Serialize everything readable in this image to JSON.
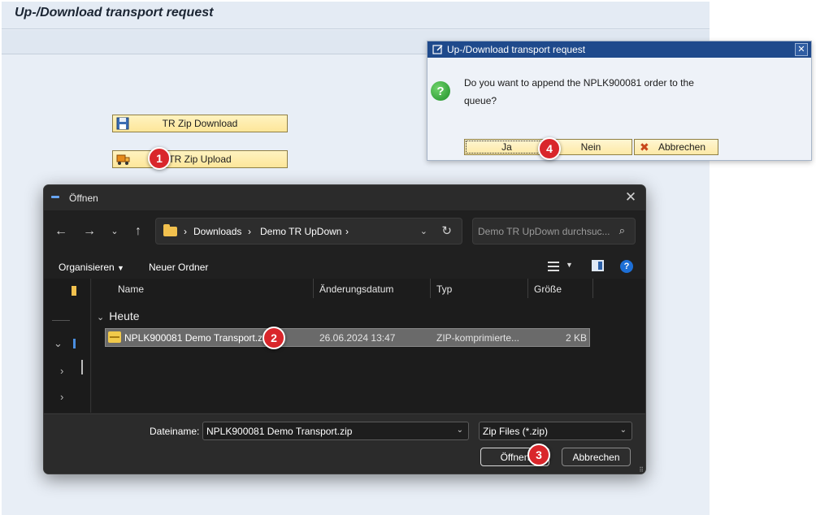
{
  "sap": {
    "title": "Up-/Download transport request",
    "buttons": {
      "download": {
        "label": "TR Zip Download",
        "icon": "floppy-disk-icon"
      },
      "upload": {
        "label": "TR Zip Upload",
        "icon": "truck-icon"
      }
    }
  },
  "confirm_dialog": {
    "title": "Up-/Download transport request",
    "message": "Do you want to append the NPLK900081 order to the queue?",
    "icon": "question-icon",
    "buttons": {
      "yes": "Ja",
      "no": "Nein",
      "cancel": "Abbrechen"
    },
    "close_icon": "close-icon"
  },
  "file_dialog": {
    "title": "Öffnen",
    "address": {
      "segments": [
        "Downloads",
        "Demo TR UpDown"
      ]
    },
    "search_placeholder": "Demo TR UpDown durchsuc...",
    "commands": {
      "organize": "Organisieren",
      "new_folder": "Neuer Ordner"
    },
    "columns": {
      "name": "Name",
      "modified": "Änderungsdatum",
      "type": "Typ",
      "size": "Größe"
    },
    "group": "Heute",
    "file": {
      "name": "NPLK900081 Demo Transport.zip",
      "modified": "26.06.2024 13:47",
      "type": "ZIP-komprimierte...",
      "size": "2 KB"
    },
    "filename_label": "Dateiname:",
    "filename_value": "NPLK900081 Demo Transport.zip",
    "filter_value": "Zip Files (*.zip)",
    "buttons": {
      "open": "Öffnen",
      "cancel": "Abbrechen"
    }
  },
  "markers": [
    "1",
    "2",
    "3",
    "4"
  ],
  "colors": {
    "marker": "#d9262b",
    "sap_button": "#fde69a",
    "sap_dialog_title": "#1f4a8c",
    "file_dialog_bg": "#202020",
    "selected_row": "#6a6a6a"
  }
}
